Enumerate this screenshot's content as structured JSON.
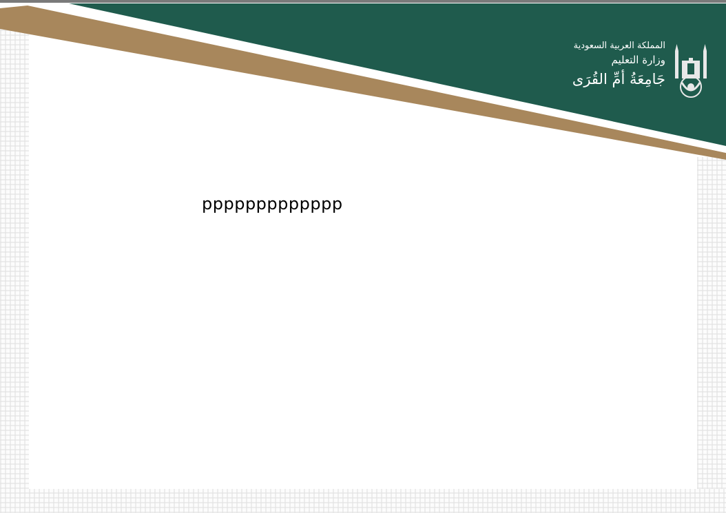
{
  "header": {
    "line1": "المملكة العربية السعودية",
    "line2": "وزارة التعليم",
    "line3": "جَامِعَةُ أمِّ القُرَى",
    "colors": {
      "green": "#1f5b4d",
      "gold": "#a8875c"
    },
    "emblem_icon": "university-emblem-icon"
  },
  "content": {
    "text": "ppppppppppppp"
  }
}
